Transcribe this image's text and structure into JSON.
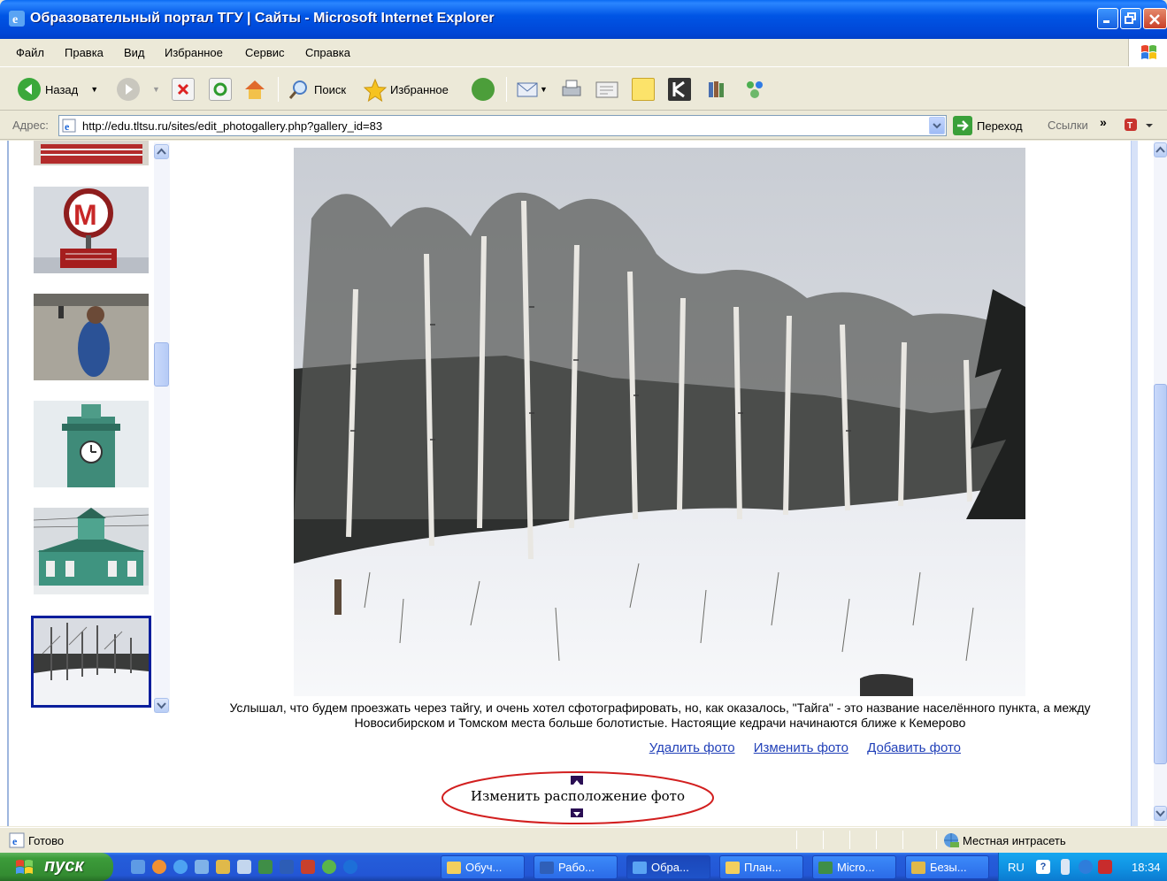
{
  "window": {
    "title": "Образовательный портал ТГУ | Сайты - Microsoft Internet Explorer"
  },
  "menu": {
    "items": [
      "Файл",
      "Правка",
      "Вид",
      "Избранное",
      "Сервис",
      "Справка"
    ]
  },
  "toolbar": {
    "back_label": "Назад",
    "search_label": "Поиск",
    "favorites_label": "Избранное"
  },
  "address": {
    "label": "Адрес:",
    "url": "http://edu.tltsu.ru/sites/edit_photogallery.php?gallery_id=83",
    "go_label": "Переход",
    "links_label": "Ссылки"
  },
  "gallery": {
    "thumbnails": [
      "metro-sign",
      "old-woman",
      "clock-tower",
      "green-station",
      "birch-forest"
    ],
    "selected_index": 4,
    "caption": "Услышал, что будем проезжать через тайгу, и очень хотел сфотографировать, но, как оказалось, \"Тайга\" - это название населённого пункта, а между Новосибирском и Томском места больше болотистые. Настоящие кедрачи начинаются ближе к Кемерово",
    "delete_label": "Удалить фото",
    "edit_label": "Изменить фото",
    "add_label": "Добавить фото",
    "relocate_label": "Изменить расположение фото"
  },
  "status": {
    "text": "Готово",
    "zone": "Местная интрасеть"
  },
  "taskbar": {
    "start_label": "пуск",
    "buttons": [
      "Обуч...",
      "Рабо...",
      "Обра...",
      "План...",
      "Micro...",
      "Безы..."
    ],
    "active_index": 2,
    "lang": "RU",
    "clock": "18:34"
  },
  "colors": {
    "title_bar": "#0055E5",
    "link": "#2140B8",
    "selection_border": "#0A1E9C",
    "annotation_ellipse": "#D21F1F"
  }
}
